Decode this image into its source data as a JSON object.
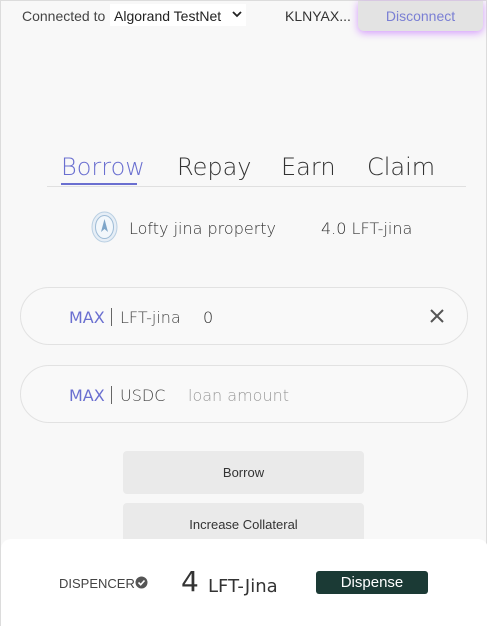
{
  "header": {
    "connected_label": "Connected to",
    "network_selected": "Algorand TestNet",
    "account": "KLNYAX...",
    "disconnect_label": "Disconnect"
  },
  "tabs": [
    {
      "label": "Borrow",
      "active": true
    },
    {
      "label": "Repay",
      "active": false
    },
    {
      "label": "Earn",
      "active": false
    },
    {
      "label": "Claim",
      "active": false
    }
  ],
  "asset": {
    "name": "Lofty jina property",
    "amount": "4.0 LFT-jina",
    "icon": "asset-coin-icon"
  },
  "collateral_input": {
    "max_label": "MAX",
    "unit": "LFT-jina",
    "value": "0"
  },
  "loan_input": {
    "max_label": "MAX",
    "unit": "USDC",
    "placeholder": "loan amount"
  },
  "actions": {
    "borrow_label": "Borrow",
    "increase_collateral_label": "Increase Collateral"
  },
  "dispenser": {
    "label": "DISPENCER",
    "amount": "4",
    "unit": "LFT-Jina",
    "button_label": "Dispense"
  },
  "colors": {
    "accent": "#6a6fd0",
    "dispense_button": "#1b3a35",
    "disconnect_glow": "#c878ff"
  }
}
